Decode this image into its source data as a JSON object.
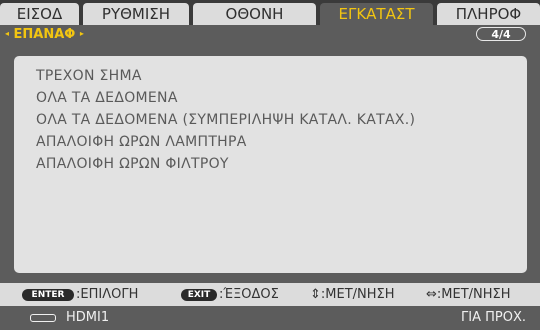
{
  "tabs": [
    {
      "label": "ΕΙΣΟΔ"
    },
    {
      "label": "ΡΥΘΜΙΣΗ"
    },
    {
      "label": "ΟΘΟΝΗ"
    },
    {
      "label": "ΕΓΚΑΤΑΣΤ"
    },
    {
      "label": "ΠΛΗΡΟΦ"
    }
  ],
  "active_tab_index": 3,
  "submenu": {
    "title": "ΕΠΑΝΑΦ",
    "page": "4/4"
  },
  "menu_items": [
    {
      "label": "ΤΡΕΧΟΝ ΣΗΜΑ"
    },
    {
      "label": "ΟΛΑ ΤΑ ΔΕΔΟΜΕΝΑ"
    },
    {
      "label": "ΟΛΑ ΤΑ ΔΕΔΟΜΕΝΑ (ΣΥΜΠΕΡΙΛΗΨΗ ΚΑΤΑΛ. ΚΑΤΑΧ.)"
    },
    {
      "label": "ΑΠΑΛΟΙΦΗ ΩΡΩΝ ΛΑΜΠΤΗΡΑ"
    },
    {
      "label": "ΑΠΑΛΟΙΦΗ ΩΡΩΝ ΦΙΛΤΡΟΥ"
    }
  ],
  "help": {
    "enter_key": "ENTER",
    "enter_label": ":ΕΠΙΛΟΓΗ",
    "exit_key": "EXIT",
    "exit_label": ":ΈΞΟΔΟΣ",
    "move_label": "⇕:ΜΕΤ/ΝΗΣΗ",
    "move_label2": "⇔:ΜΕΤ/ΝΗΣΗ"
  },
  "status": {
    "source": "HDMI1",
    "right_text": "ΓΙΑ ΠΡΟΧ."
  },
  "colors": {
    "accent": "#f2c511",
    "panel": "#e2e2e2",
    "header": "#5c5c5c"
  },
  "icons": {
    "left_arrow": "◂",
    "right_arrow": "▸"
  }
}
